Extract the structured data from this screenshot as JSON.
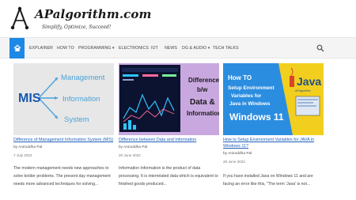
{
  "site": {
    "title": "APalgorithm.com",
    "tagline": "Simplify, Optimize, Succeed!"
  },
  "nav": {
    "home_icon": "home-icon",
    "items": [
      {
        "label": "EXPLAINER"
      },
      {
        "label": "HOW TO"
      },
      {
        "label": "PROGRAMMING",
        "has_dropdown": true
      },
      {
        "label": "ELECTRONICS"
      },
      {
        "label": "IOT"
      },
      {
        "label": "NEWS"
      },
      {
        "label": "DG & AUDIO",
        "has_dropdown": true
      },
      {
        "label": "TECH TALKS"
      }
    ],
    "search_icon": "search-icon",
    "dropdown_caret": "▾",
    "accent": "#1e88e5"
  },
  "posts": [
    {
      "title": "Difference of Management Information System (MIS)",
      "author": "by Aniruddha Pal",
      "date": "7 July 2022",
      "excerpt": "The modern management needs new approaches to solve bolder problems. The present day management needs more advanced techniques for solving...",
      "thumb": {
        "words": [
          "MIS",
          "Management",
          "Information",
          "System"
        ]
      }
    },
    {
      "title": "Difference between Data and Information",
      "author": "by Aniruddha Pal",
      "date": "20 June 2022",
      "excerpt": "Information  Information is the product of data processing. It is interrelated data which is equivalent to finished goods produced...",
      "thumb": {
        "words": [
          "Difference",
          "b/w",
          "Data &",
          "Information"
        ]
      }
    },
    {
      "title": "How to Setup Environment Variables for JAVA in Windows 11?",
      "author": "by Aniruddha Pal",
      "date": "28 June 2022",
      "excerpt": "If you have installed Java on Windows 11 and are facing an error like this, \"The term 'Java' is not...",
      "thumb": {
        "words": [
          "How TO",
          "Setup Environment",
          "Variables for",
          "Java in Windows",
          "Windows 11",
          "Java",
          "APalgorithm"
        ]
      }
    }
  ]
}
